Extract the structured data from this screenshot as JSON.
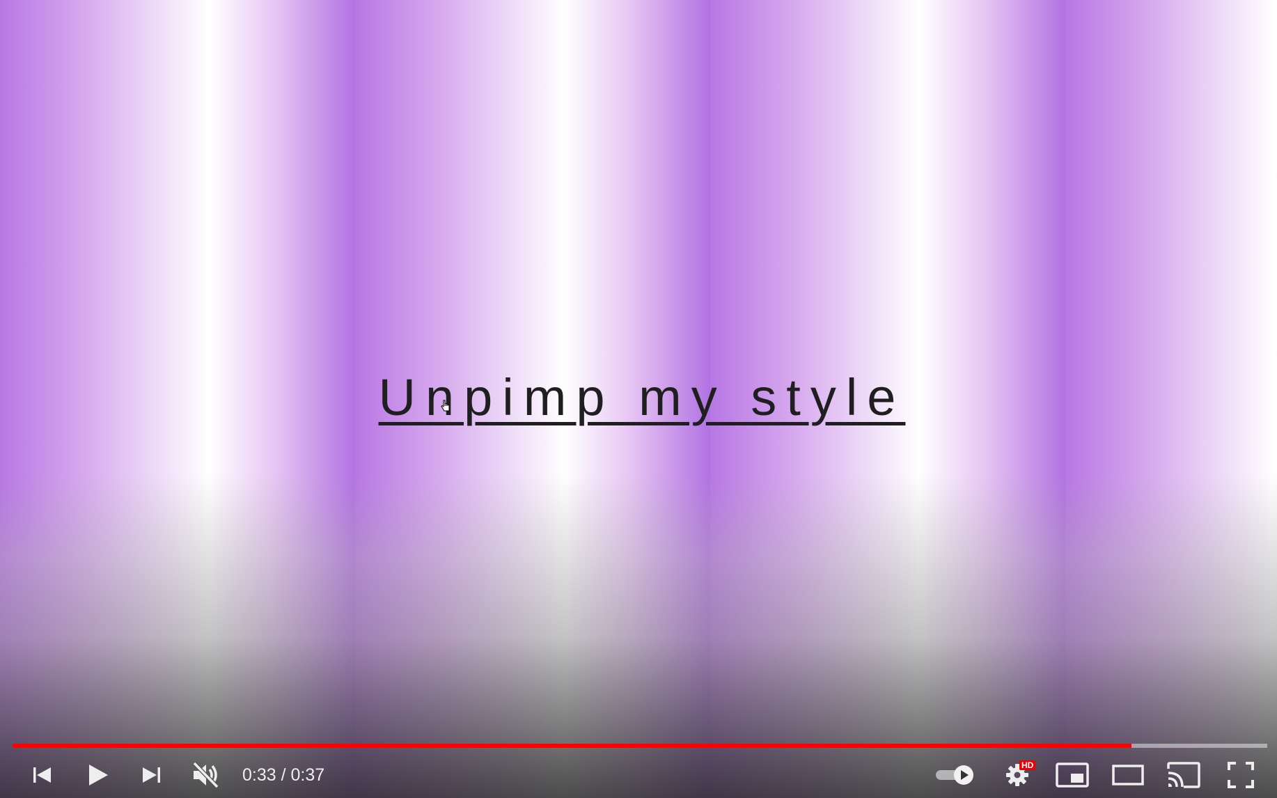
{
  "video": {
    "title_text": "Unpimp my style"
  },
  "player": {
    "time_display": "0:33 / 0:37",
    "progress": 0.892,
    "colors": {
      "progress_played": "#ff0000",
      "title_text": "#1f1f1f"
    },
    "controls": {
      "previous": {
        "icon": "skip-previous-icon"
      },
      "play": {
        "icon": "play-icon"
      },
      "next": {
        "icon": "skip-next-icon"
      },
      "volume": {
        "icon": "volume-muted-icon"
      },
      "autoplay": {
        "icon": "autoplay-toggle-icon"
      },
      "settings": {
        "icon": "gear-icon",
        "badge": "HD"
      },
      "miniplayer": {
        "icon": "miniplayer-icon"
      },
      "theater": {
        "icon": "theater-mode-icon"
      },
      "cast": {
        "icon": "cast-icon"
      },
      "fullscreen": {
        "icon": "fullscreen-icon"
      }
    }
  }
}
